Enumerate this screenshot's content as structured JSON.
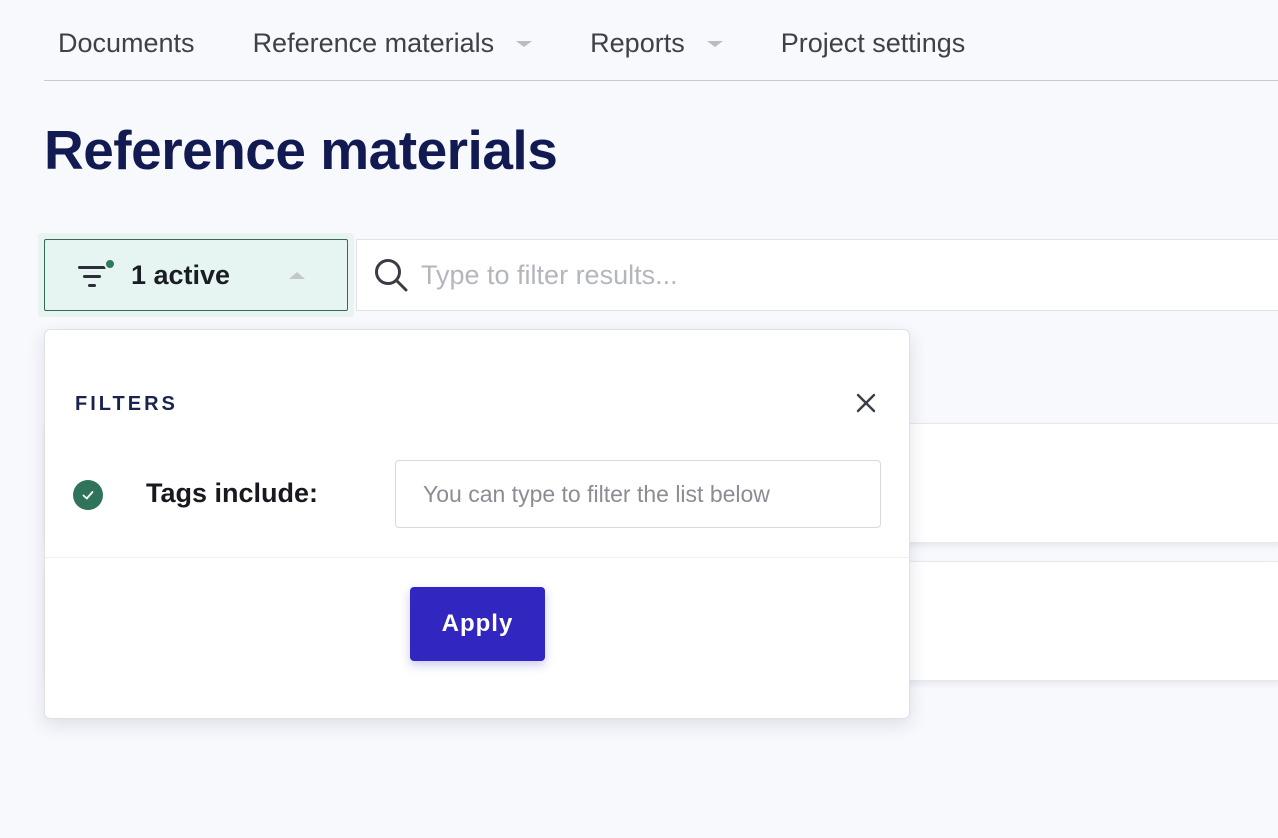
{
  "nav": {
    "items": [
      {
        "label": "Documents",
        "has_dropdown": false
      },
      {
        "label": "Reference materials",
        "has_dropdown": true
      },
      {
        "label": "Reports",
        "has_dropdown": true
      },
      {
        "label": "Project settings",
        "has_dropdown": false
      }
    ]
  },
  "page": {
    "title": "Reference materials"
  },
  "filter_toggle": {
    "label": "1 active",
    "icon": "filter-icon",
    "active_color": "#2f7a5c"
  },
  "search": {
    "placeholder": "Type to filter results...",
    "value": "",
    "icon": "search-icon"
  },
  "filters_panel": {
    "heading": "FILTERS",
    "close_icon": "close-icon",
    "tags": {
      "label": "Tags include:",
      "placeholder": "You can type to filter the list below",
      "value": "",
      "status_icon": "check-circle-icon"
    },
    "apply_label": "Apply"
  },
  "colors": {
    "accent": "#3127c0",
    "title": "#121a52",
    "success": "#2f735a",
    "filter_bg": "#e6f5f1"
  }
}
